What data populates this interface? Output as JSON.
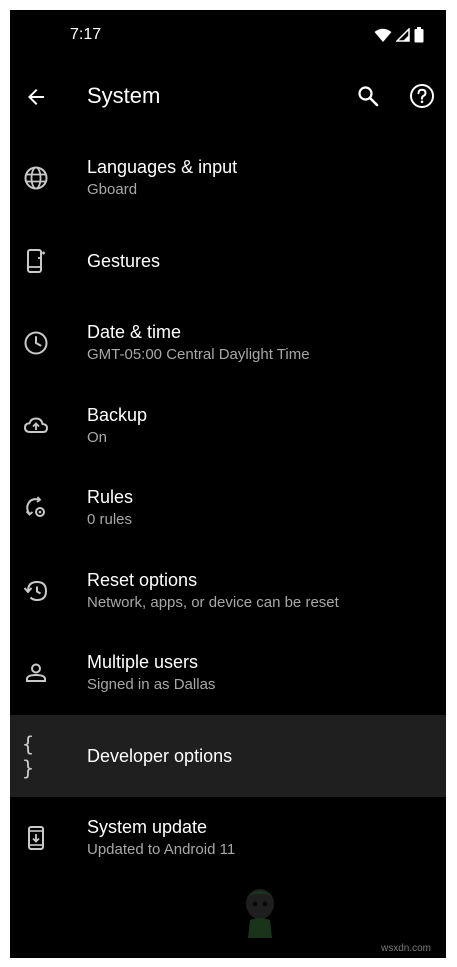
{
  "status_bar": {
    "time": "7:17",
    "icons": [
      "wifi-icon",
      "signal-icon",
      "battery-icon"
    ]
  },
  "app_bar": {
    "title": "System",
    "back_icon": "arrow-back-icon",
    "search_icon": "search-icon",
    "help_icon": "help-icon"
  },
  "settings": {
    "items": [
      {
        "title": "Languages & input",
        "subtitle": "Gboard",
        "icon": "globe-icon"
      },
      {
        "title": "Gestures",
        "subtitle": "",
        "icon": "gestures-phone-icon"
      },
      {
        "title": "Date & time",
        "subtitle": "GMT-05:00 Central Daylight Time",
        "icon": "clock-icon"
      },
      {
        "title": "Backup",
        "subtitle": "On",
        "icon": "cloud-upload-icon"
      },
      {
        "title": "Rules",
        "subtitle": "0 rules",
        "icon": "rules-icon"
      },
      {
        "title": "Reset options",
        "subtitle": "Network, apps, or device can be reset",
        "icon": "history-icon"
      },
      {
        "title": "Multiple users",
        "subtitle": "Signed in as Dallas",
        "icon": "person-icon"
      },
      {
        "title": "Developer options",
        "subtitle": "",
        "icon": "braces-icon",
        "braces": "{ }"
      },
      {
        "title": "System update",
        "subtitle": "Updated to Android 11",
        "icon": "system-update-icon"
      }
    ]
  },
  "colors": {
    "background": "#000000",
    "highlight_row": "#1f1f1f",
    "title_text": "#ffffff",
    "subtitle_text": "#a8a8a8",
    "icon": "#c9c9c9"
  },
  "watermark": "wsxdn.com"
}
